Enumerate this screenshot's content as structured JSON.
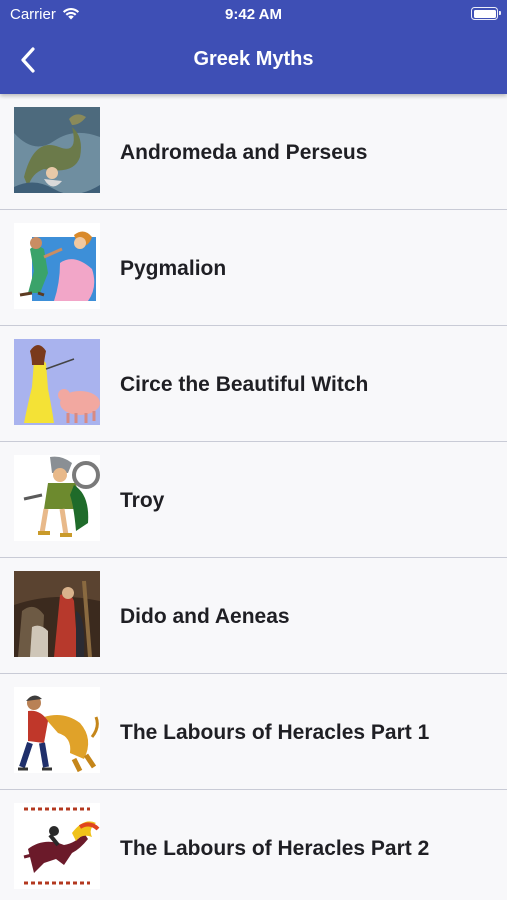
{
  "status_bar": {
    "carrier": "Carrier",
    "time": "9:42 AM"
  },
  "nav": {
    "title": "Greek Myths",
    "back_icon": "chevron-left-icon"
  },
  "colors": {
    "header_bg": "#3e4fb5",
    "list_bg": "#f8f8fa",
    "divider": "#c9cbd6",
    "text": "#1f1f24"
  },
  "myths": [
    {
      "title": "Andromeda and Perseus",
      "thumbnail": "sea-monster-illustration"
    },
    {
      "title": "Pygmalion",
      "thumbnail": "sculptor-and-statue-illustration"
    },
    {
      "title": "Circe the Beautiful Witch",
      "thumbnail": "witch-and-pig-illustration"
    },
    {
      "title": "Troy",
      "thumbnail": "warrior-illustration"
    },
    {
      "title": "Dido and Aeneas",
      "thumbnail": "classical-painting"
    },
    {
      "title": "The Labours of Heracles Part 1",
      "thumbnail": "heracles-and-lion-illustration"
    },
    {
      "title": "The Labours of Heracles Part 2",
      "thumbnail": "winged-horse-rider-illustration"
    }
  ]
}
